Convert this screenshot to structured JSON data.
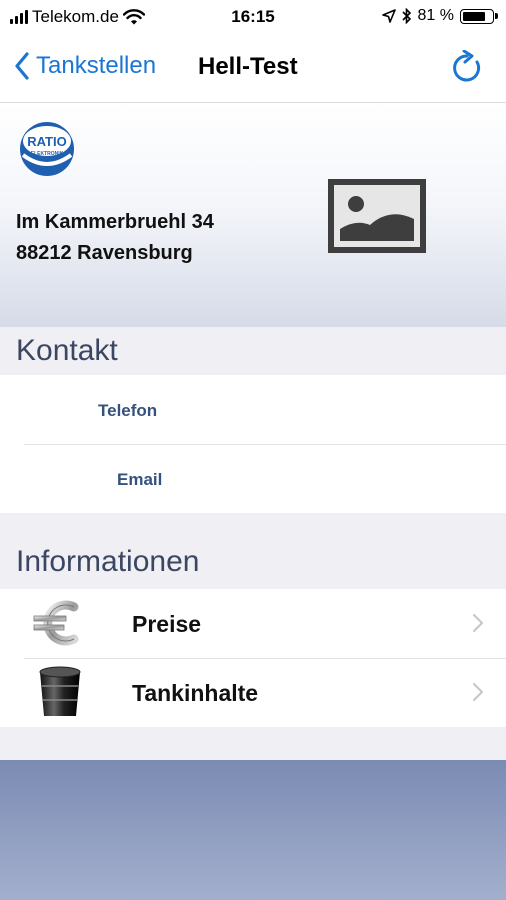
{
  "status_bar": {
    "carrier": "Telekom.de",
    "time": "16:15",
    "battery_percent": "81 %",
    "battery_level": 0.81
  },
  "nav": {
    "back_label": "Tankstellen",
    "title": "Hell-Test",
    "refresh_icon": "refresh-icon"
  },
  "header": {
    "logo_text": "RATIO",
    "logo_subtext": "ELEKTRONIK",
    "address_line1": "Im Kammerbruehl 34",
    "address_line2": "88212 Ravensburg",
    "image_icon": "image-placeholder-icon"
  },
  "contact": {
    "title": "Kontakt",
    "phone_label": "Telefon",
    "email_label": "Email"
  },
  "info": {
    "title": "Informationen",
    "items": [
      {
        "label": "Preise",
        "icon": "euro-icon"
      },
      {
        "label": "Tankinhalte",
        "icon": "tank-icon"
      }
    ]
  },
  "colors": {
    "accent": "#1a76d2",
    "section_title": "#3b4663",
    "contact_label": "#35527e",
    "footer": "#7b8bb3"
  }
}
